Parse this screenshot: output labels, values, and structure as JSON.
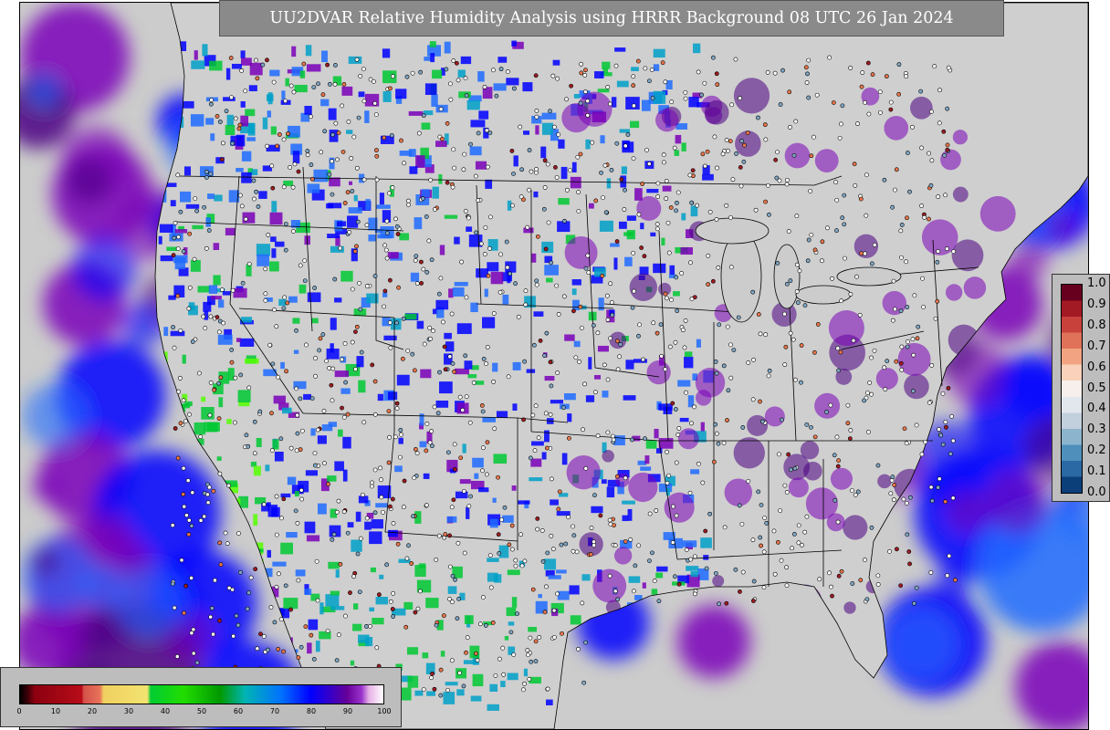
{
  "title": "UU2DVAR Relative Humidity Analysis using HRRR Background 08 UTC 26 Jan 2024",
  "map": {
    "projection": "lambert-conformal",
    "region": "CONUS",
    "background_color": "#cccccc",
    "field_colors": [
      "#4b0082",
      "#7a00b8",
      "#0000ff",
      "#1e6bff",
      "#00a0c8",
      "#00c832",
      "#55ff00",
      "#ffffff"
    ],
    "observation_marker_colors": [
      "#ffffff",
      "#7fa6c4",
      "#e8754a",
      "#9b1b20"
    ]
  },
  "qc_colorbar": {
    "ticks": [
      "1.0",
      "0.9",
      "0.8",
      "0.7",
      "0.6",
      "0.5",
      "0.4",
      "0.3",
      "0.2",
      "0.1",
      "0.0"
    ],
    "colors": [
      "#67001f",
      "#a21a24",
      "#c8413b",
      "#e0725a",
      "#f2a482",
      "#fad1ba",
      "#f6efec",
      "#e2e7ee",
      "#c2cfdc",
      "#8cb5cd",
      "#4f8fbb",
      "#2a69a4",
      "#0b3f7a"
    ]
  },
  "rh_colorbar": {
    "ticks": [
      "0",
      "10",
      "20",
      "30",
      "40",
      "50",
      "60",
      "70",
      "80",
      "90",
      "100"
    ],
    "stops": [
      {
        "v": 0,
        "c": "#000000"
      },
      {
        "v": 2,
        "c": "#3a0008"
      },
      {
        "v": 4,
        "c": "#8b0010"
      },
      {
        "v": 17,
        "c": "#b80c18"
      },
      {
        "v": 17.5,
        "c": "#d4504a"
      },
      {
        "v": 22,
        "c": "#e8735a"
      },
      {
        "v": 23,
        "c": "#f0d060"
      },
      {
        "v": 35,
        "c": "#f3e370"
      },
      {
        "v": 36,
        "c": "#00cc33"
      },
      {
        "v": 45,
        "c": "#22dd00"
      },
      {
        "v": 55,
        "c": "#009900"
      },
      {
        "v": 62,
        "c": "#00b4b4"
      },
      {
        "v": 72,
        "c": "#0070ff"
      },
      {
        "v": 80,
        "c": "#0000ff"
      },
      {
        "v": 85,
        "c": "#3300cc"
      },
      {
        "v": 90,
        "c": "#660099"
      },
      {
        "v": 94,
        "c": "#9933cc"
      },
      {
        "v": 96,
        "c": "#e6b0e6"
      },
      {
        "v": 100,
        "c": "#ffffff"
      }
    ]
  }
}
